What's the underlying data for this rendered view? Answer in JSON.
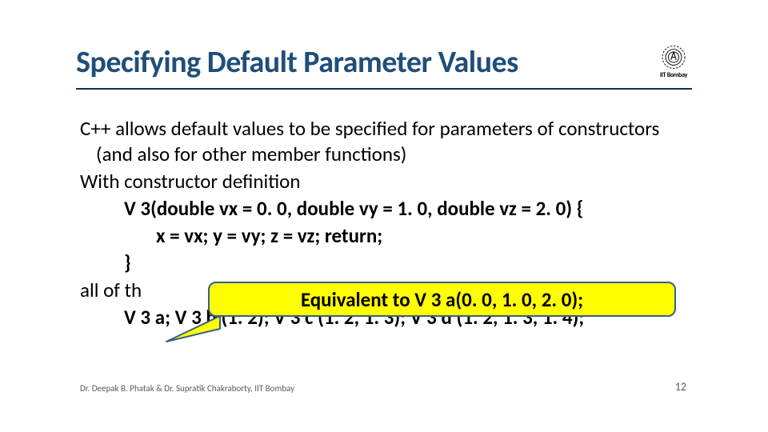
{
  "title": "Specifying Default Parameter Values",
  "logo_caption": "IIT Bombay",
  "body": {
    "l1": "C++ allows default values to be specified for parameters of constructors (and also for other member functions)",
    "l2": "With constructor definition",
    "l3": "V 3(double vx = 0. 0, double vy = 1. 0,  double vz = 2. 0) {",
    "l4": "x = vx; y = vy; z = vz; return;",
    "l5": "}",
    "l6": "all of th",
    "l7": "V 3 a;  V 3 b (1. 2);  V 3 c (1. 2, 1. 3);  V 3 d (1. 2, 1. 3, 1. 4);"
  },
  "callout": "Equivalent to V 3 a(0. 0, 1. 0, 2. 0);",
  "footer_left": "Dr. Deepak B. Phatak & Dr. Supratik Chakraborty, IIT Bombay",
  "page_number": "12"
}
